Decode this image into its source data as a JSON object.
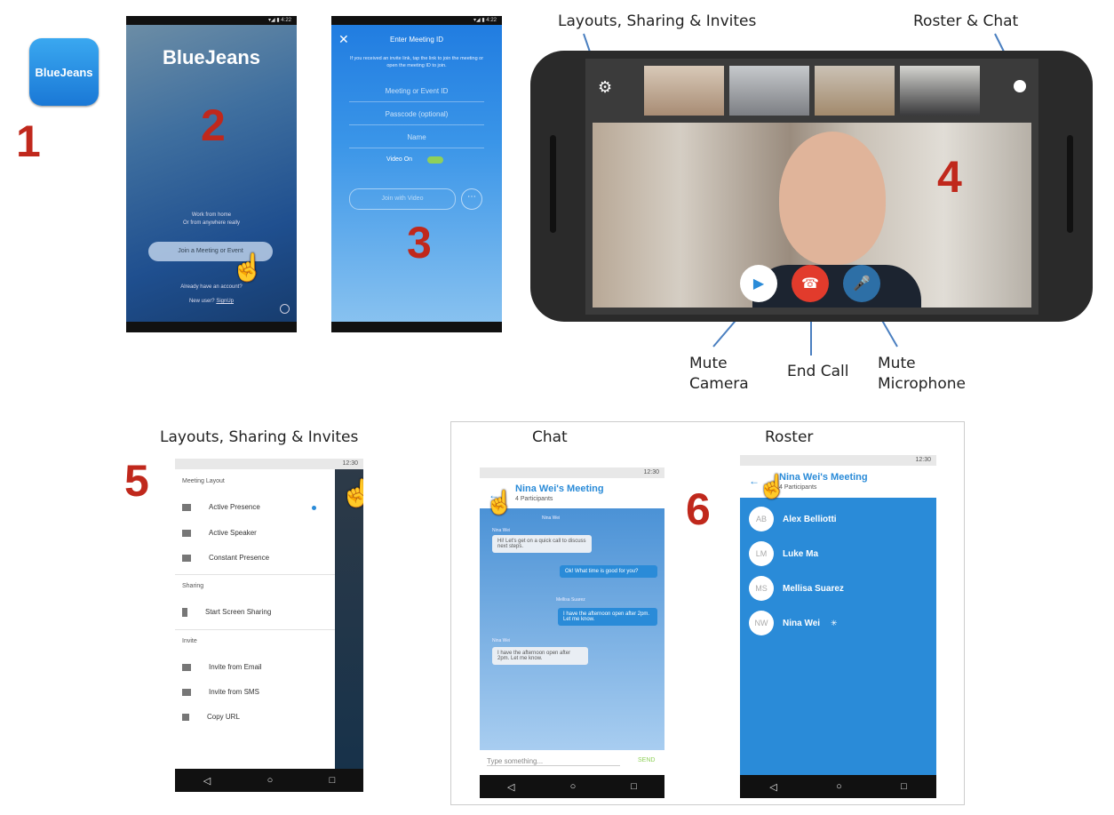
{
  "steps": {
    "s1": "1",
    "s2": "2",
    "s3": "3",
    "s4": "4",
    "s5": "5",
    "s6": "6"
  },
  "app_icon": {
    "label": "BlueJeans"
  },
  "screen2": {
    "logo": "BlueJeans",
    "tagline1": "Work from home",
    "tagline2": "Or from anywhere really",
    "join_button": "Join a Meeting or Event",
    "account_text": "Already have an account?",
    "new_user": "New user?",
    "signup": "SignUp"
  },
  "screen3": {
    "title": "Enter Meeting ID",
    "info": "If you received an invite link, tap the link to join the meeting or open the meeting ID to join.",
    "field_meeting_id": "Meeting or Event ID",
    "field_passcode": "Passcode (optional)",
    "field_name": "Name",
    "video_toggle": "Video On",
    "join_button": "Join with Video"
  },
  "screen4": {
    "caption_layouts": "Layouts, Sharing & Invites",
    "caption_roster": "Roster & Chat",
    "mute_camera_1": "Mute",
    "mute_camera_2": "Camera",
    "end_call": "End Call",
    "mute_mic_1": "Mute",
    "mute_mic_2": "Microphone"
  },
  "screen5": {
    "caption": "Layouts, Sharing & Invites",
    "status_time": "12:30",
    "section_layout": "Meeting Layout",
    "active_presence": "Active Presence",
    "active_speaker": "Active Speaker",
    "constant_presence": "Constant Presence",
    "section_sharing": "Sharing",
    "start_screen_sharing": "Start Screen Sharing",
    "section_invite": "Invite",
    "invite_email": "Invite from Email",
    "invite_sms": "Invite from SMS",
    "copy_url": "Copy URL"
  },
  "chat": {
    "caption": "Chat",
    "status_time": "12:30",
    "title": "Nina Wei's Meeting",
    "subtitle": "4 Participants",
    "sender1": "Nina Wei",
    "msg1": "Hi! Let's get on a quick call to discuss next steps.",
    "msg2": "Ok! What time is good for you?",
    "sender2": "Mellisa Suarez",
    "msg3": "I have the afternoon open after 2pm. Let me know.",
    "sender3": "Nina Wei",
    "msg4": "I have the afternoon open after 2pm. Let me know.",
    "input_placeholder": "Type something...",
    "send": "SEND"
  },
  "roster": {
    "caption": "Roster",
    "status_time": "12:30",
    "title": "Nina Wei's Meeting",
    "subtitle": "4 Participants",
    "people": [
      {
        "initials": "AB",
        "name": "Alex Belliotti"
      },
      {
        "initials": "LM",
        "name": "Luke Ma"
      },
      {
        "initials": "MS",
        "name": "Mellisa Suarez"
      },
      {
        "initials": "NW",
        "name": "Nina Wei"
      }
    ]
  },
  "nav": {
    "back": "◁",
    "home": "○",
    "recent": "□"
  },
  "colors": {
    "step_red": "#c0281c",
    "bj_blue": "#2a8bd8",
    "end_red": "#e23b2c"
  }
}
